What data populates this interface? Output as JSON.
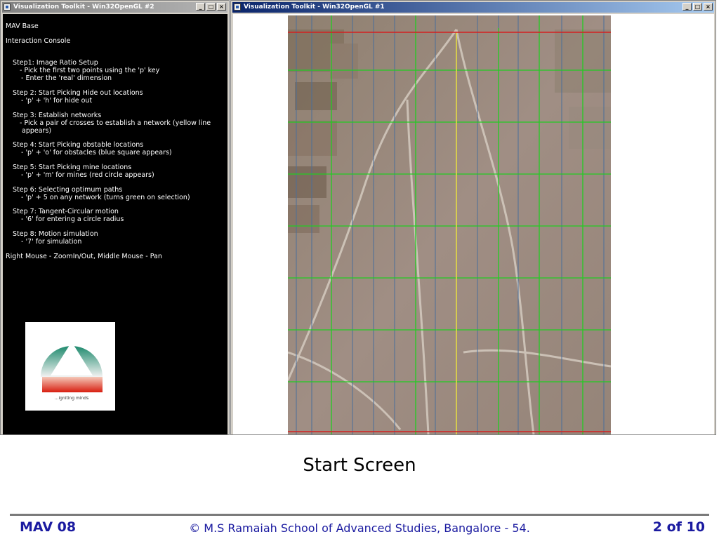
{
  "left_window": {
    "title": "Visualization Toolkit - Win32OpenGL #2",
    "console_lines": [
      "MAV Base",
      "Interaction Console",
      "Step1: Image Ratio Setup",
      "- Pick the first two points using the 'p' key",
      "- Enter the 'real' dimension",
      "Step 2: Start Picking Hide out locations",
      "- 'p' + 'h' for hide out",
      "Step 3: Establish networks",
      "- Pick a pair of crosses to establish a network (yellow line",
      "appears)",
      "Step 4: Start Picking obstable locations",
      "- 'p' + 'o' for obstacles (blue square appears)",
      "Step 5: Start Picking mine locations",
      "- 'p' + 'm' for mines (red circle appears)",
      "Step 6: Selecting optimum paths",
      "- 'p' + 5 on any network (turns green on selection)",
      "Step 7: Tangent-Circular motion",
      "- '6' for entering a circle radius",
      "Step 8: Motion simulation",
      "- '7' for simulation",
      "Right Mouse - ZoomIn/Out, Middle Mouse - Pan"
    ],
    "logo_tagline": "...igniting minds"
  },
  "right_window": {
    "title": "Visualization Toolkit - Win32OpenGL #1"
  },
  "window_buttons": {
    "minimize": "_",
    "maximize": "□",
    "close": "×"
  },
  "caption": "Start Screen",
  "footer": {
    "left": "MAV 08",
    "center": "© M.S Ramaiah School of Advanced Studies, Bangalore - 54.",
    "right": "2 of 10"
  },
  "colors": {
    "footer_text": "#1a1aa0",
    "grid_green": "#22cc22",
    "grid_blue": "#4a6e9a",
    "network_yellow": "#e8e040",
    "boundary_red": "#d42020",
    "terrain": "#9a8a80"
  }
}
